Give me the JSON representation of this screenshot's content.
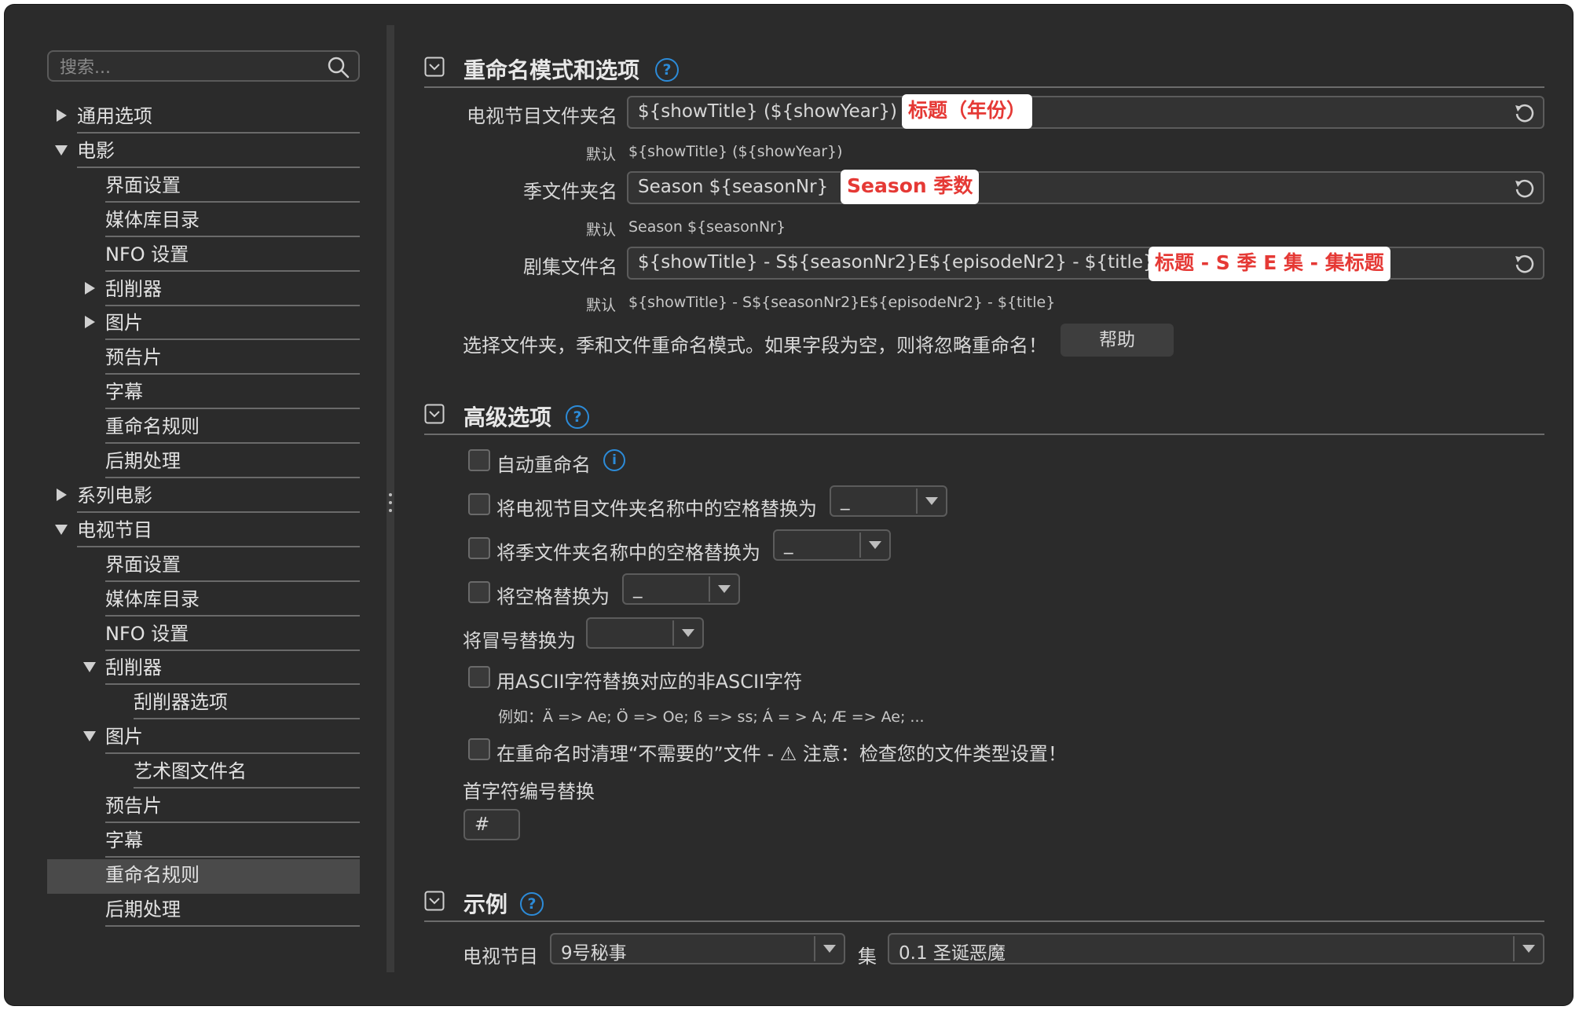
{
  "search": {
    "placeholder": "搜索..."
  },
  "tree": [
    {
      "label": "通用选项",
      "arrow": "right"
    },
    {
      "label": "电影",
      "arrow": "down"
    },
    {
      "label": "界面设置",
      "arrow": ""
    },
    {
      "label": "媒体库目录",
      "arrow": ""
    },
    {
      "label": "NFO 设置",
      "arrow": ""
    },
    {
      "label": "刮削器",
      "arrow": "right"
    },
    {
      "label": "图片",
      "arrow": "right"
    },
    {
      "label": "预告片",
      "arrow": ""
    },
    {
      "label": "字幕",
      "arrow": ""
    },
    {
      "label": "重命名规则",
      "arrow": ""
    },
    {
      "label": "后期处理",
      "arrow": ""
    },
    {
      "label": "系列电影",
      "arrow": "right"
    },
    {
      "label": "电视节目",
      "arrow": "down"
    },
    {
      "label": "界面设置",
      "arrow": ""
    },
    {
      "label": "媒体库目录",
      "arrow": ""
    },
    {
      "label": "NFO 设置",
      "arrow": ""
    },
    {
      "label": "刮削器",
      "arrow": "down"
    },
    {
      "label": "刮削器选项",
      "arrow": ""
    },
    {
      "label": "图片",
      "arrow": "down"
    },
    {
      "label": "艺术图文件名",
      "arrow": ""
    },
    {
      "label": "预告片",
      "arrow": ""
    },
    {
      "label": "字幕",
      "arrow": ""
    },
    {
      "label": "重命名规则",
      "arrow": "",
      "selected": true
    },
    {
      "label": "后期处理",
      "arrow": ""
    }
  ],
  "rename": {
    "title": "重命名模式和选项",
    "tv_folder": {
      "label": "电视节目文件夹名",
      "value": "${showTitle} (${showYear})",
      "hint": "标题（年份）",
      "default_label": "默认",
      "default_value": "${showTitle} (${showYear})"
    },
    "season_folder": {
      "label": "季文件夹名",
      "value": "Season ${seasonNr}",
      "hint": "Season 季数",
      "default_label": "默认",
      "default_value": "Season ${seasonNr}"
    },
    "episode_file": {
      "label": "剧集文件名",
      "value": "${showTitle} - S${seasonNr2}E${episodeNr2} - ${title}",
      "hint": "标题 - S 季 E 集 - 集标题",
      "default_label": "默认",
      "default_value": "${showTitle} - S${seasonNr2}E${episodeNr2} - ${title}"
    },
    "description": "选择文件夹，季和文件重命名模式。如果字段为空，则将忽略重命名！",
    "help_button": "帮助"
  },
  "advanced": {
    "title": "高级选项",
    "auto_rename": "自动重命名",
    "replace_tv_space": "将电视节目文件夹名称中的空格替换为",
    "replace_tv_space_value": "_",
    "replace_season_space": "将季文件夹名称中的空格替换为",
    "replace_season_space_value": "_",
    "replace_space": "将空格替换为",
    "replace_space_value": "_",
    "replace_colon": "将冒号替换为",
    "replace_colon_value": "",
    "ascii": "用ASCII字符替换对应的非ASCII字符",
    "ascii_example": "例如：Ä => Ae; Ö => Oe; ß => ss; Á = > A; Æ => Ae; ...",
    "cleanup": "在重命名时清理“不需要的”文件 - ⚠ 注意：检查您的文件类型设置！",
    "first_char_label": "首字符编号替换",
    "first_char_value": "#"
  },
  "example": {
    "title": "示例",
    "tv_label": "电视节目",
    "tv_value": "9号秘事",
    "episode_label": "集",
    "episode_value": "0.1 圣诞恶魔"
  },
  "colors": {
    "accent": "#2c8bd8",
    "hint_text": "#e53935",
    "background": "#2b2b2b"
  }
}
